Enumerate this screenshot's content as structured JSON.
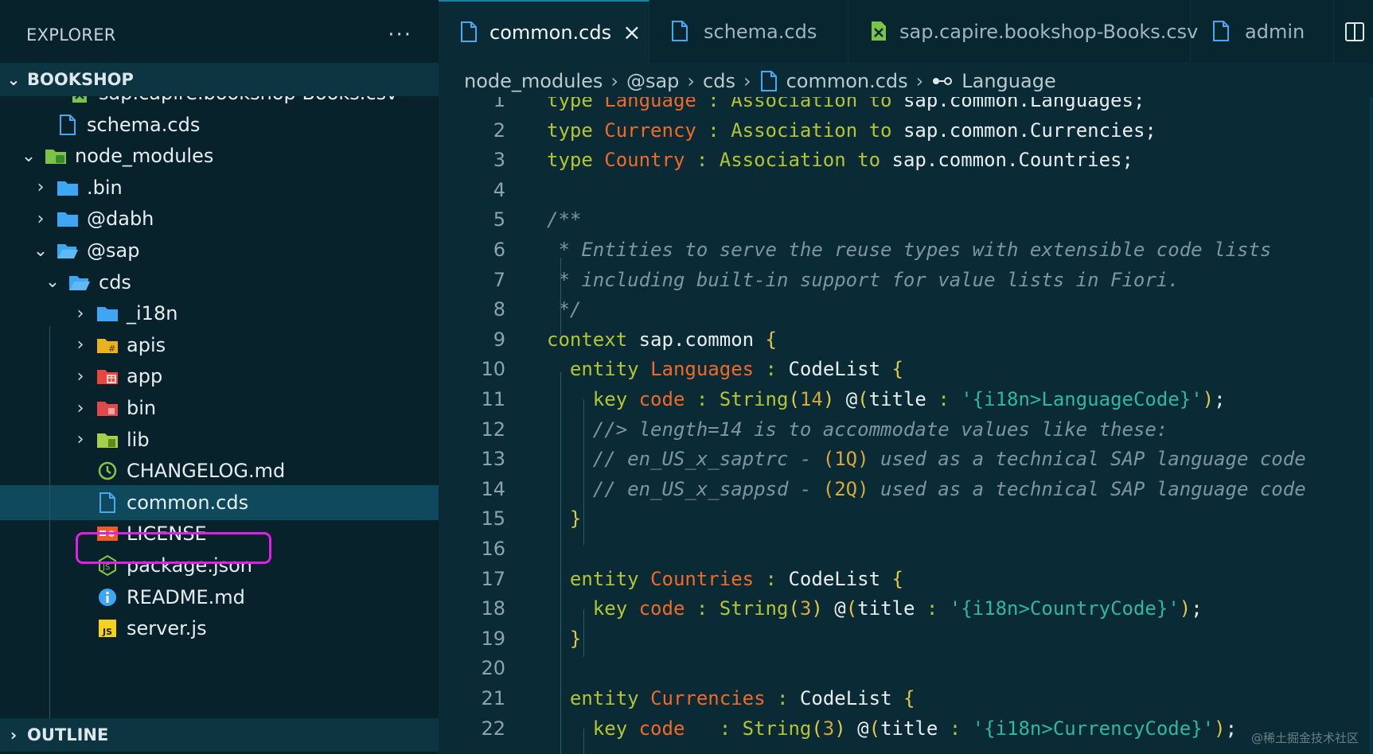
{
  "sidebar": {
    "title": "EXPLORER",
    "more": "···",
    "root_section": "BOOKSHOP",
    "outline_section": "OUTLINE",
    "tree": [
      {
        "label": "sap.capire.bookshop-Books.csv",
        "icon": "csv-icon",
        "arrow": "",
        "depth": 2
      },
      {
        "label": "schema.cds",
        "icon": "file-icon",
        "arrow": "",
        "depth": 1
      },
      {
        "label": "node_modules",
        "icon": "folder-node-icon",
        "arrow": "expanded",
        "depth": 0
      },
      {
        "label": ".bin",
        "icon": "folder-icon",
        "arrow": "collapsed",
        "depth": 1
      },
      {
        "label": "@dabh",
        "icon": "folder-icon",
        "arrow": "collapsed",
        "depth": 1
      },
      {
        "label": "@sap",
        "icon": "folder-open-icon",
        "arrow": "expanded",
        "depth": 1
      },
      {
        "label": "cds",
        "icon": "folder-open-icon",
        "arrow": "expanded",
        "depth": 2
      },
      {
        "label": "_i18n",
        "icon": "folder-icon",
        "arrow": "collapsed",
        "depth": 3
      },
      {
        "label": "apis",
        "icon": "folder-api-icon",
        "arrow": "collapsed",
        "depth": 3
      },
      {
        "label": "app",
        "icon": "folder-app-icon",
        "arrow": "collapsed",
        "depth": 3
      },
      {
        "label": "bin",
        "icon": "folder-bin-icon",
        "arrow": "collapsed",
        "depth": 3
      },
      {
        "label": "lib",
        "icon": "folder-lib-icon",
        "arrow": "collapsed",
        "depth": 3
      },
      {
        "label": "CHANGELOG.md",
        "icon": "changelog-icon",
        "arrow": "",
        "depth": 3
      },
      {
        "label": "common.cds",
        "icon": "file-icon",
        "arrow": "",
        "depth": 3,
        "selected": true
      },
      {
        "label": "LICENSE",
        "icon": "license-icon",
        "arrow": "",
        "depth": 3
      },
      {
        "label": "package.json",
        "icon": "nodejs-icon",
        "arrow": "",
        "depth": 3
      },
      {
        "label": "README.md",
        "icon": "info-icon",
        "arrow": "",
        "depth": 3
      },
      {
        "label": "server.js",
        "icon": "js-icon",
        "arrow": "",
        "depth": 3
      }
    ]
  },
  "tabs": [
    {
      "label": "common.cds",
      "icon": "file-icon",
      "active": true,
      "close": "×"
    },
    {
      "label": "schema.cds",
      "icon": "file-icon",
      "active": false
    },
    {
      "label": "sap.capire.bookshop-Books.csv",
      "icon": "csv-icon",
      "active": false
    },
    {
      "label": "admin",
      "icon": "file-icon",
      "active": false
    }
  ],
  "breadcrumb": {
    "items": [
      "node_modules",
      "@sap",
      "cds",
      "common.cds",
      "Language"
    ],
    "separator": "›"
  },
  "editor": {
    "lines": [
      {
        "n": "1",
        "tokens": [
          [
            "kw",
            "type "
          ],
          [
            "id",
            "Language"
          ],
          [
            "op",
            " : "
          ],
          [
            "kw",
            "Association to "
          ],
          [
            "tx",
            "sap.common.Languages;"
          ]
        ]
      },
      {
        "n": "2",
        "tokens": [
          [
            "kw",
            "type "
          ],
          [
            "id",
            "Currency"
          ],
          [
            "op",
            " : "
          ],
          [
            "kw",
            "Association to "
          ],
          [
            "tx",
            "sap.common.Currencies;"
          ]
        ]
      },
      {
        "n": "3",
        "tokens": [
          [
            "kw",
            "type "
          ],
          [
            "id",
            "Country"
          ],
          [
            "op",
            " : "
          ],
          [
            "kw",
            "Association to "
          ],
          [
            "tx",
            "sap.common.Countries;"
          ]
        ]
      },
      {
        "n": "4",
        "tokens": []
      },
      {
        "n": "5",
        "tokens": [
          [
            "cm",
            "/**"
          ]
        ]
      },
      {
        "n": "6",
        "tokens": [
          [
            "cm",
            " * Entities to serve the reuse types with extensible code lists"
          ]
        ]
      },
      {
        "n": "7",
        "tokens": [
          [
            "cm",
            " * including built-in support for value lists in Fiori."
          ]
        ]
      },
      {
        "n": "8",
        "tokens": [
          [
            "cm",
            " */"
          ]
        ]
      },
      {
        "n": "9",
        "tokens": [
          [
            "kw",
            "context "
          ],
          [
            "tx",
            "sap.common "
          ],
          [
            "br",
            "{"
          ]
        ]
      },
      {
        "n": "10",
        "tokens": [
          [
            "tx",
            "  "
          ],
          [
            "kw",
            "entity "
          ],
          [
            "id",
            "Languages"
          ],
          [
            "op",
            " : "
          ],
          [
            "tx",
            "CodeList "
          ],
          [
            "br",
            "{"
          ]
        ]
      },
      {
        "n": "11",
        "tokens": [
          [
            "tx",
            "    "
          ],
          [
            "kw",
            "key "
          ],
          [
            "id",
            "code"
          ],
          [
            "op",
            " : "
          ],
          [
            "kw",
            "String"
          ],
          [
            "br",
            "("
          ],
          [
            "nm",
            "14"
          ],
          [
            "br",
            ")"
          ],
          [
            "tx",
            " @"
          ],
          [
            "br",
            "("
          ],
          [
            "tx",
            "title"
          ],
          [
            "op",
            " : "
          ],
          [
            "st",
            "'{i18n>LanguageCode}'"
          ],
          [
            "br",
            ")"
          ],
          [
            "tx",
            ";"
          ]
        ]
      },
      {
        "n": "12",
        "tokens": [
          [
            "tx",
            "    "
          ],
          [
            "cm",
            "//> length=14 is to accommodate values like these:"
          ]
        ]
      },
      {
        "n": "13",
        "tokens": [
          [
            "tx",
            "    "
          ],
          [
            "cm",
            "// en_US_x_saptrc - "
          ],
          [
            "nm",
            "(1Q)"
          ],
          [
            "cm",
            " used as a technical SAP language code"
          ]
        ]
      },
      {
        "n": "14",
        "tokens": [
          [
            "tx",
            "    "
          ],
          [
            "cm",
            "// en_US_x_sappsd - "
          ],
          [
            "nm",
            "(2Q)"
          ],
          [
            "cm",
            " used as a technical SAP language code"
          ]
        ]
      },
      {
        "n": "15",
        "tokens": [
          [
            "tx",
            "  "
          ],
          [
            "br",
            "}"
          ]
        ]
      },
      {
        "n": "16",
        "tokens": []
      },
      {
        "n": "17",
        "tokens": [
          [
            "tx",
            "  "
          ],
          [
            "kw",
            "entity "
          ],
          [
            "id",
            "Countries"
          ],
          [
            "op",
            " : "
          ],
          [
            "tx",
            "CodeList "
          ],
          [
            "br",
            "{"
          ]
        ]
      },
      {
        "n": "18",
        "tokens": [
          [
            "tx",
            "    "
          ],
          [
            "kw",
            "key "
          ],
          [
            "id",
            "code"
          ],
          [
            "op",
            " : "
          ],
          [
            "kw",
            "String"
          ],
          [
            "br",
            "("
          ],
          [
            "nm",
            "3"
          ],
          [
            "br",
            ")"
          ],
          [
            "tx",
            " @"
          ],
          [
            "br",
            "("
          ],
          [
            "tx",
            "title"
          ],
          [
            "op",
            " : "
          ],
          [
            "st",
            "'{i18n>CountryCode}'"
          ],
          [
            "br",
            ")"
          ],
          [
            "tx",
            ";"
          ]
        ]
      },
      {
        "n": "19",
        "tokens": [
          [
            "tx",
            "  "
          ],
          [
            "br",
            "}"
          ]
        ]
      },
      {
        "n": "20",
        "tokens": []
      },
      {
        "n": "21",
        "tokens": [
          [
            "tx",
            "  "
          ],
          [
            "kw",
            "entity "
          ],
          [
            "id",
            "Currencies"
          ],
          [
            "op",
            " : "
          ],
          [
            "tx",
            "CodeList "
          ],
          [
            "br",
            "{"
          ]
        ]
      },
      {
        "n": "22",
        "tokens": [
          [
            "tx",
            "    "
          ],
          [
            "kw",
            "key "
          ],
          [
            "id",
            "code"
          ],
          [
            "op",
            "   : "
          ],
          [
            "kw",
            "String"
          ],
          [
            "br",
            "("
          ],
          [
            "nm",
            "3"
          ],
          [
            "br",
            ")"
          ],
          [
            "tx",
            " @"
          ],
          [
            "br",
            "("
          ],
          [
            "tx",
            "title"
          ],
          [
            "op",
            " : "
          ],
          [
            "st",
            "'{i18n>CurrencyCode}'"
          ],
          [
            "br",
            ")"
          ],
          [
            "tx",
            ";"
          ]
        ]
      }
    ]
  },
  "watermark": "@稀土掘金技术社区"
}
